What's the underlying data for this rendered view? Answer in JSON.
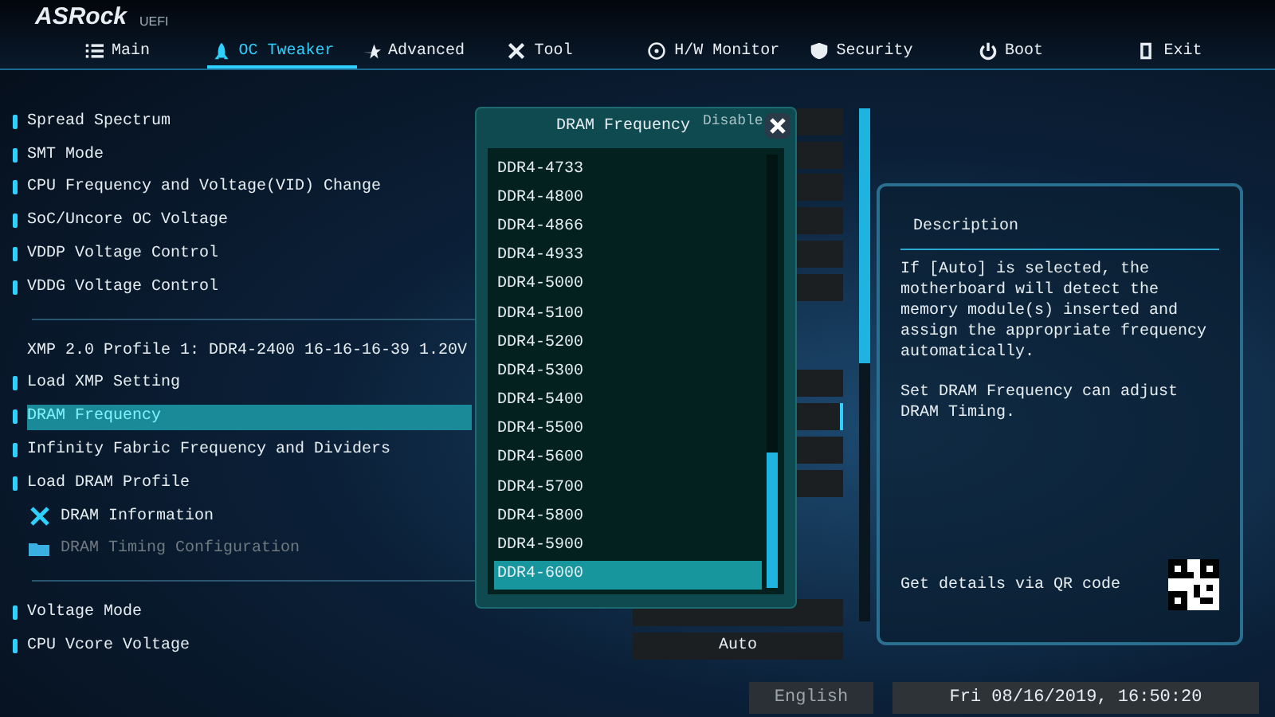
{
  "header": {
    "logo": "ASRock",
    "logo_sub": "UEFI"
  },
  "tabs": [
    {
      "label": "Main",
      "selected": false
    },
    {
      "label": "OC Tweaker",
      "selected": true
    },
    {
      "label": "Advanced",
      "selected": false
    },
    {
      "label": "Tool",
      "selected": false
    },
    {
      "label": "H/W Monitor",
      "selected": false
    },
    {
      "label": "Security",
      "selected": false
    },
    {
      "label": "Boot",
      "selected": false
    },
    {
      "label": "Exit",
      "selected": false
    }
  ],
  "settings": {
    "groups": [
      {
        "items": [
          {
            "kind": "item",
            "label": "Spread Spectrum",
            "selected": false,
            "value": "Disable"
          },
          {
            "kind": "item",
            "label": "SMT Mode",
            "selected": false
          },
          {
            "kind": "item",
            "label": "CPU Frequency and Voltage(VID) Change",
            "selected": false
          },
          {
            "kind": "item",
            "label": "SoC/Uncore OC Voltage",
            "selected": false
          },
          {
            "kind": "item",
            "label": "VDDP Voltage Control",
            "selected": false
          },
          {
            "kind": "item",
            "label": "VDDG Voltage Control",
            "selected": false
          }
        ]
      },
      {
        "items": [
          {
            "kind": "info",
            "label": "XMP 2.0 Profile 1: DDR4-2400 16-16-16-39 1.20V"
          },
          {
            "kind": "item",
            "label": "Load XMP Setting",
            "selected": false
          },
          {
            "kind": "item",
            "label": "DRAM Frequency",
            "selected": true
          },
          {
            "kind": "item",
            "label": "Infinity Fabric Frequency and Dividers",
            "selected": false
          },
          {
            "kind": "item",
            "label": "Load DRAM Profile",
            "selected": false
          },
          {
            "kind": "tool",
            "label": "DRAM Information",
            "selected": false
          },
          {
            "kind": "folder",
            "label": "DRAM Timing Configuration",
            "selected": false,
            "disabled": true
          }
        ]
      },
      {
        "items": [
          {
            "kind": "item",
            "label": "Voltage Mode",
            "selected": false
          },
          {
            "kind": "item",
            "label": "CPU Vcore Voltage",
            "selected": false,
            "value": "Auto"
          }
        ]
      }
    ]
  },
  "popup": {
    "title": "DRAM Frequency",
    "options": [
      {
        "label": "DDR4-4733",
        "selected": false
      },
      {
        "label": "DDR4-4800",
        "selected": false
      },
      {
        "label": "DDR4-4866",
        "selected": false
      },
      {
        "label": "DDR4-4933",
        "selected": false
      },
      {
        "label": "DDR4-5000",
        "selected": false
      },
      {
        "label": "DDR4-5100",
        "selected": false
      },
      {
        "label": "DDR4-5200",
        "selected": false
      },
      {
        "label": "DDR4-5300",
        "selected": false
      },
      {
        "label": "DDR4-5400",
        "selected": false
      },
      {
        "label": "DDR4-5500",
        "selected": false
      },
      {
        "label": "DDR4-5600",
        "selected": false
      },
      {
        "label": "DDR4-5700",
        "selected": false
      },
      {
        "label": "DDR4-5800",
        "selected": false
      },
      {
        "label": "DDR4-5900",
        "selected": false
      },
      {
        "label": "DDR4-6000",
        "selected": true
      }
    ]
  },
  "description": {
    "heading": "Description",
    "paragraphs": [
      "If [Auto] is selected, the motherboard will detect the memory module(s) inserted and assign the appropriate frequency automatically.",
      "Set DRAM Frequency can adjust DRAM Timing."
    ],
    "qr_caption": "Get details via QR code"
  },
  "status_bar": {
    "language": "English",
    "datetime": "Fri 08/16/2019, 16:50:20"
  }
}
